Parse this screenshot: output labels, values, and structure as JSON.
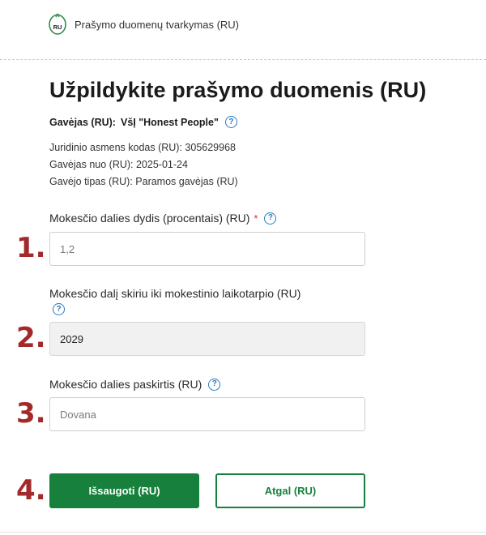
{
  "header": {
    "logo_text": "RU",
    "app_title": "Prašymo duomenų tvarkymas (RU)"
  },
  "page": {
    "title": "Užpildykite prašymo duomenis (RU)"
  },
  "recipient": {
    "label": "Gavėjas (RU):",
    "name": "VšĮ \"Honest People\"",
    "help_icon": "question-circle-icon",
    "code": "Juridinio asmens kodas (RU): 305629968",
    "since": "Gavėjas nuo (RU): 2025-01-24",
    "type": "Gavėjo tipas (RU): Paramos gavėjas (RU)"
  },
  "form": {
    "share_size": {
      "label": "Mokesčio dalies dydis (procentais) (RU)",
      "required_mark": "*",
      "value": "1,2"
    },
    "period": {
      "label": "Mokesčio dalį skiriu iki mokestinio laikotarpio (RU)",
      "value": "2029"
    },
    "purpose": {
      "label": "Mokesčio dalies paskirtis (RU)",
      "value": "Dovana"
    }
  },
  "steps": [
    "1.",
    "2.",
    "3.",
    "4."
  ],
  "buttons": {
    "save": "Išsaugoti (RU)",
    "back": "Atgal (RU)"
  },
  "colors": {
    "primary": "#16803c",
    "help": "#2a7bbf",
    "step_marker": "#a32a2a",
    "required": "#d0312d"
  }
}
